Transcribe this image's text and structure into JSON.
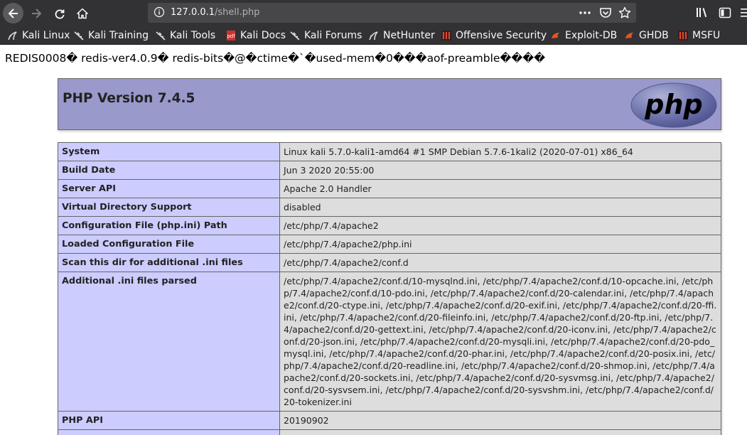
{
  "browser": {
    "url_host": "127.0.0.1",
    "url_path": "/shell.php",
    "bookmarks": [
      {
        "label": "Kali Linux",
        "icon": "kali-dragon-icon"
      },
      {
        "label": "Kali Training",
        "icon": "kali-dragon-icon"
      },
      {
        "label": "Kali Tools",
        "icon": "kali-dragon-icon"
      },
      {
        "label": "Kali Docs",
        "icon": "kali-docs-icon"
      },
      {
        "label": "Kali Forums",
        "icon": "kali-dragon-icon"
      },
      {
        "label": "NetHunter",
        "icon": "kali-dragon-icon"
      },
      {
        "label": "Offensive Security",
        "icon": "offsec-icon"
      },
      {
        "label": "Exploit-DB",
        "icon": "exploitdb-icon"
      },
      {
        "label": "GHDB",
        "icon": "exploitdb-icon"
      },
      {
        "label": "MSFU",
        "icon": "offsec-icon"
      }
    ]
  },
  "page": {
    "redis_dump": "REDIS0008� redis-ver4.0.9� redis-bits�@�ctime�`�used-mem�0���aof-preamble����",
    "php_version_title": "PHP Version 7.4.5",
    "logo_text": "php",
    "rows": [
      {
        "key": "System",
        "value": "Linux kali 5.7.0-kali1-amd64 #1 SMP Debian 5.7.6-1kali2 (2020-07-01) x86_64"
      },
      {
        "key": "Build Date",
        "value": "Jun 3 2020 20:55:00"
      },
      {
        "key": "Server API",
        "value": "Apache 2.0 Handler"
      },
      {
        "key": "Virtual Directory Support",
        "value": "disabled"
      },
      {
        "key": "Configuration File (php.ini) Path",
        "value": "/etc/php/7.4/apache2"
      },
      {
        "key": "Loaded Configuration File",
        "value": "/etc/php/7.4/apache2/php.ini"
      },
      {
        "key": "Scan this dir for additional .ini files",
        "value": "/etc/php/7.4/apache2/conf.d"
      },
      {
        "key": "Additional .ini files parsed",
        "value": "/etc/php/7.4/apache2/conf.d/10-mysqlnd.ini, /etc/php/7.4/apache2/conf.d/10-opcache.ini, /etc/php/7.4/apache2/conf.d/10-pdo.ini, /etc/php/7.4/apache2/conf.d/20-calendar.ini, /etc/php/7.4/apache2/conf.d/20-ctype.ini, /etc/php/7.4/apache2/conf.d/20-exif.ini, /etc/php/7.4/apache2/conf.d/20-ffi.ini, /etc/php/7.4/apache2/conf.d/20-fileinfo.ini, /etc/php/7.4/apache2/conf.d/20-ftp.ini, /etc/php/7.4/apache2/conf.d/20-gettext.ini, /etc/php/7.4/apache2/conf.d/20-iconv.ini, /etc/php/7.4/apache2/conf.d/20-json.ini, /etc/php/7.4/apache2/conf.d/20-mysqli.ini, /etc/php/7.4/apache2/conf.d/20-pdo_mysql.ini, /etc/php/7.4/apache2/conf.d/20-phar.ini, /etc/php/7.4/apache2/conf.d/20-posix.ini, /etc/php/7.4/apache2/conf.d/20-readline.ini, /etc/php/7.4/apache2/conf.d/20-shmop.ini, /etc/php/7.4/apache2/conf.d/20-sockets.ini, /etc/php/7.4/apache2/conf.d/20-sysvmsg.ini, /etc/php/7.4/apache2/conf.d/20-sysvsem.ini, /etc/php/7.4/apache2/conf.d/20-sysvshm.ini, /etc/php/7.4/apache2/conf.d/20-tokenizer.ini"
      },
      {
        "key": "PHP API",
        "value": "20190902"
      },
      {
        "key": "",
        "value": ""
      }
    ]
  }
}
